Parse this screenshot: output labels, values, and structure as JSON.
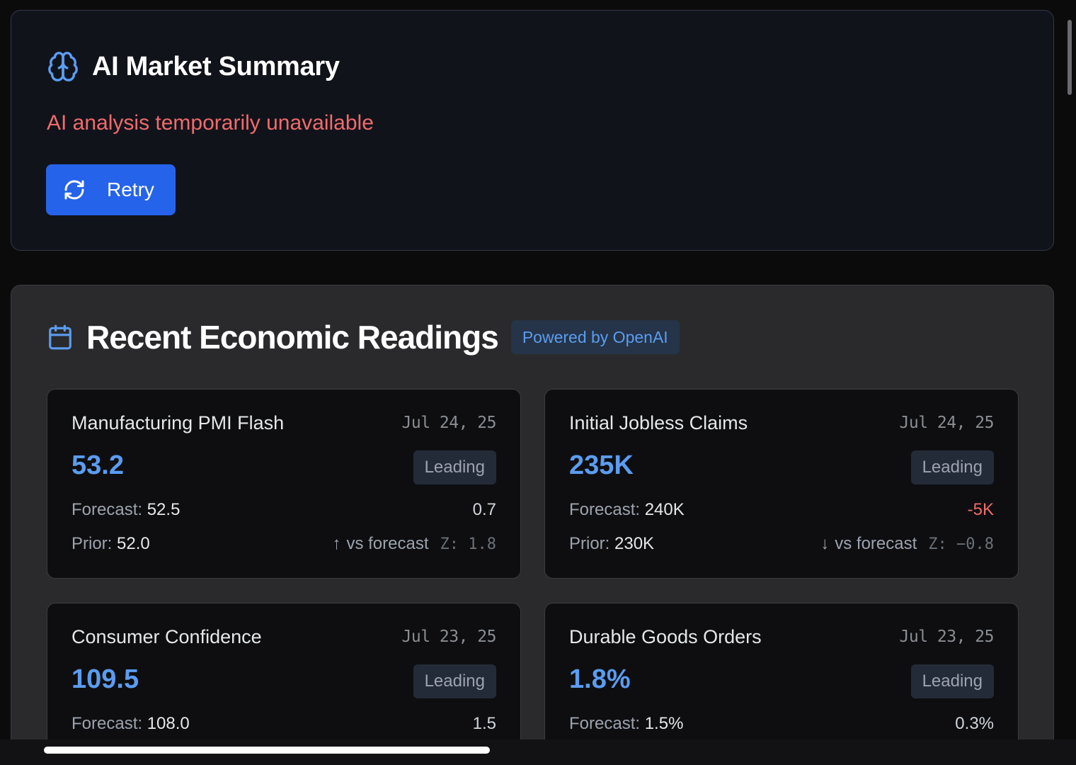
{
  "summary": {
    "title": "AI Market Summary",
    "icon": "brain-icon",
    "error": "AI analysis temporarily unavailable",
    "retry_label": "Retry",
    "accent": "#2563eb",
    "error_color": "#f16b6b"
  },
  "readings": {
    "title": "Recent Economic Readings",
    "icon": "calendar-icon",
    "badge": "Powered by OpenAI",
    "cards": [
      {
        "name": "Manufacturing PMI Flash",
        "date": "Jul 24, 25",
        "value": "53.2",
        "tag": "Leading",
        "forecast_label": "Forecast:",
        "forecast": "52.5",
        "diff": "0.7",
        "prior_label": "Prior:",
        "prior": "52.0",
        "direction_arrow": "↑",
        "vs_label": "vs forecast",
        "z": "Z: 1.8"
      },
      {
        "name": "Initial Jobless Claims",
        "date": "Jul 24, 25",
        "value": "235K",
        "tag": "Leading",
        "forecast_label": "Forecast:",
        "forecast": "240K",
        "diff": "-5K",
        "prior_label": "Prior:",
        "prior": "230K",
        "direction_arrow": "↓",
        "vs_label": "vs forecast",
        "z": "Z: −0.8"
      },
      {
        "name": "Consumer Confidence",
        "date": "Jul 23, 25",
        "value": "109.5",
        "tag": "Leading",
        "forecast_label": "Forecast:",
        "forecast": "108.0",
        "diff": "1.5"
      },
      {
        "name": "Durable Goods Orders",
        "date": "Jul 23, 25",
        "value": "1.8%",
        "tag": "Leading",
        "forecast_label": "Forecast:",
        "forecast": "1.5%",
        "diff": "0.3%"
      }
    ]
  }
}
